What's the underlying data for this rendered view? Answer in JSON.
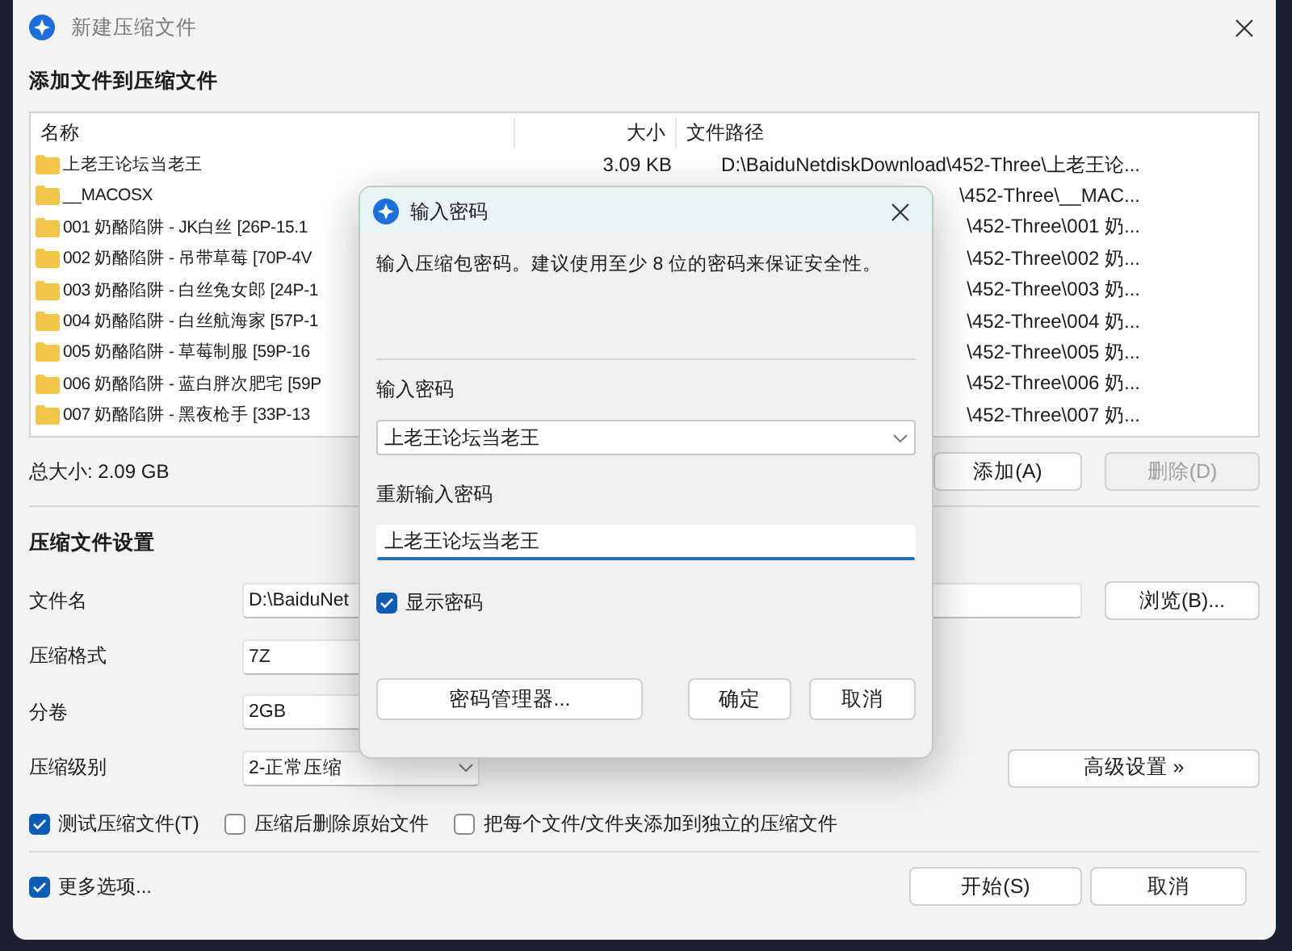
{
  "window": {
    "title": "新建压缩文件"
  },
  "files": {
    "heading": "添加文件到压缩文件",
    "columns": [
      "名称",
      "大小",
      "文件路径"
    ],
    "rows": [
      {
        "name": "上老王论坛当老王",
        "size": "3.09 KB",
        "path": "D:\\BaiduNetdiskDownload\\452-Three\\上老王论..."
      },
      {
        "name": "__MACOSX",
        "path": "\\452-Three\\__MAC..."
      },
      {
        "name": "001 奶酪陷阱 - JK白丝 [26P-15.1",
        "path": "\\452-Three\\001 奶..."
      },
      {
        "name": "002 奶酪陷阱 - 吊带草莓 [70P-4V",
        "path": "\\452-Three\\002 奶..."
      },
      {
        "name": "003 奶酪陷阱 - 白丝兔女郎 [24P-1",
        "path": "\\452-Three\\003 奶..."
      },
      {
        "name": "004 奶酪陷阱 - 白丝航海家 [57P-1",
        "path": "\\452-Three\\004 奶..."
      },
      {
        "name": "005 奶酪陷阱 - 草莓制服 [59P-16",
        "path": "\\452-Three\\005 奶..."
      },
      {
        "name": "006 奶酪陷阱 - 蓝白胖次肥宅 [59P",
        "path": "\\452-Three\\006 奶..."
      },
      {
        "name": "007 奶酪陷阱 - 黑夜枪手 [33P-13",
        "path": "\\452-Three\\007 奶..."
      }
    ],
    "total": "总大小: 2.09 GB",
    "buttons": [
      {
        "label": "添加(A)",
        "disabled": false
      },
      {
        "label": "删除(D)",
        "disabled": true
      }
    ]
  },
  "settings": {
    "heading": "压缩文件设置",
    "fields": [
      {
        "label": "文件名",
        "kind": "text",
        "value": "D:\\BaiduNet"
      },
      {
        "label": "压缩格式",
        "kind": "text",
        "value": "7Z"
      },
      {
        "label": "分卷",
        "kind": "text",
        "value": "2GB"
      },
      {
        "label": "压缩级别",
        "kind": "select",
        "value": "2-正常压缩"
      }
    ],
    "browse_button": "浏览(B)...",
    "advanced_button": "高级设置 »",
    "options": [
      {
        "label": "测试压缩文件(T)",
        "checked": true
      },
      {
        "label": "压缩后删除原始文件",
        "checked": false
      },
      {
        "label": "把每个文件/文件夹添加到独立的压缩文件",
        "checked": false
      }
    ]
  },
  "footer": {
    "more_options": {
      "label": "更多选项...",
      "checked": true
    },
    "buttons": [
      "开始(S)",
      "取消"
    ]
  },
  "password_dialog": {
    "title": "输入密码",
    "message": "输入压缩包密码。建议使用至少 8 位的密码来保证安全性。",
    "password_label": "输入密码",
    "password": "上老王论坛当老王",
    "confirm_label": "重新输入密码",
    "confirm": "上老王论坛当老王",
    "show_password": {
      "label": "显示密码",
      "checked": true
    },
    "buttons": [
      "密码管理器...",
      "确定",
      "取消"
    ]
  }
}
